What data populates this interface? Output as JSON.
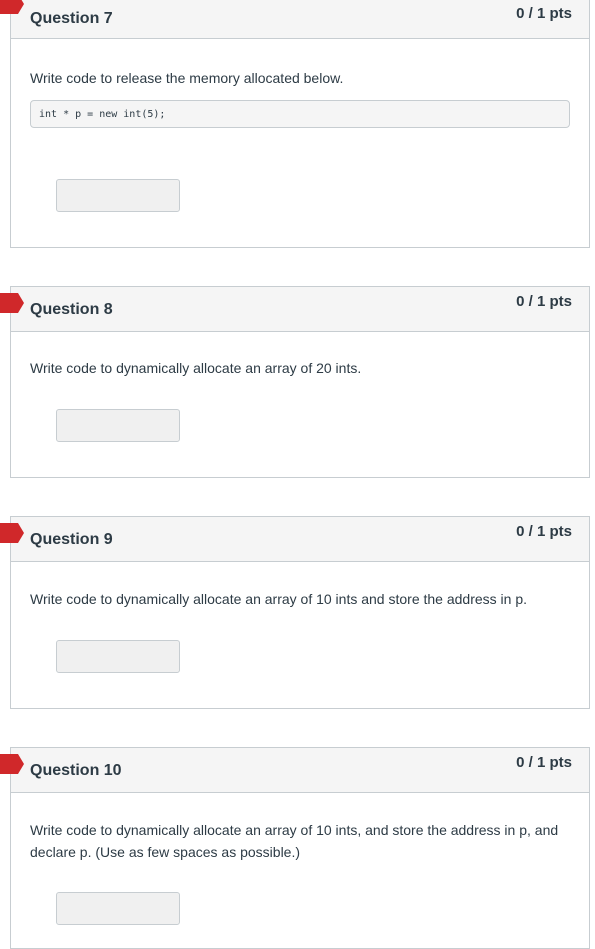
{
  "colors": {
    "flag": "#d0282a",
    "header_bg": "#f5f5f5",
    "border": "#c7cdd1",
    "text": "#2d3b45"
  },
  "questions": [
    {
      "title": "Question 7",
      "points": "0 / 1 pts",
      "prompt": "Write code to release the memory allocated below.",
      "code": "int * p = new int(5);",
      "answer": ""
    },
    {
      "title": "Question 8",
      "points": "0 / 1 pts",
      "prompt": "Write code to dynamically allocate an array of 20 ints.",
      "answer": ""
    },
    {
      "title": "Question 9",
      "points": "0 / 1 pts",
      "prompt": "Write code to dynamically allocate an array of 10 ints and store the address in p.",
      "answer": ""
    },
    {
      "title": "Question 10",
      "points": "0 / 1 pts",
      "prompt": "Write code to dynamically allocate an array of 10 ints, and store the address in p, and declare p. (Use as few spaces as possible.)",
      "answer": ""
    }
  ]
}
